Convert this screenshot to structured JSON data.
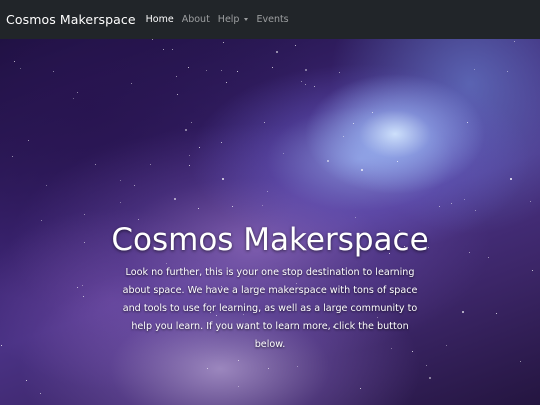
{
  "navbar": {
    "brand": "Cosmos Makerspace",
    "links": [
      {
        "label": "Home",
        "active": true
      },
      {
        "label": "About",
        "active": false
      },
      {
        "label": "Help",
        "active": false,
        "dropdown": true
      },
      {
        "label": "Events",
        "active": false
      }
    ],
    "icons": {
      "dropdown": "chevron-down-icon"
    }
  },
  "hero": {
    "title": "Cosmos Makerspace",
    "text": "Look no further, this is your one stop destination to learning about space. We have a large makerspace with tons of space and tools to use for learning, as well as a large community to help you learn. If you want to learn more, click the button below.",
    "background": "galaxy-nebula-image"
  },
  "colors": {
    "navbar_bg": "#212529",
    "nav_active": "#ffffff",
    "nav_inactive": "rgba(255,255,255,0.55)"
  }
}
